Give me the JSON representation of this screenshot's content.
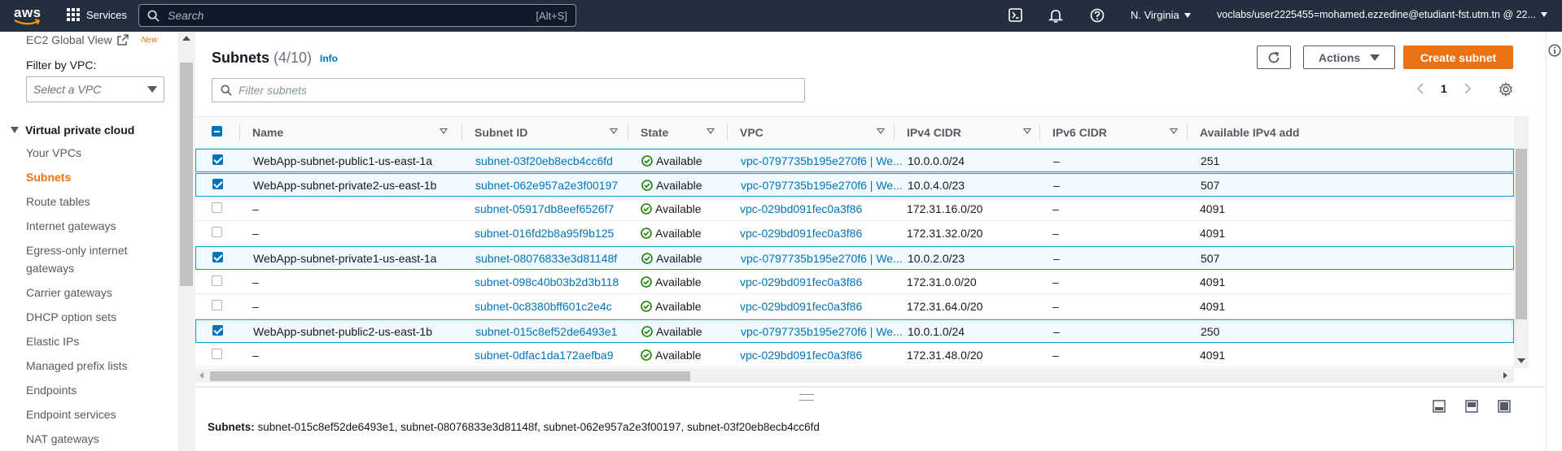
{
  "topbar": {
    "logo_text": "aws",
    "services_label": "Services",
    "search_placeholder": "Search",
    "search_shortcut": "[Alt+S]",
    "region_label": "N. Virginia",
    "account_label": "voclabs/user2225455=mohamed.ezzedine@etudiant-fst.utm.tn @ 22...",
    "colors": {
      "bg": "#232f3e",
      "accent": "#ec7211"
    }
  },
  "sidebar": {
    "global_view_label": "EC2 Global View",
    "new_badge": "New",
    "filter_label": "Filter by VPC:",
    "filter_placeholder": "Select a VPC",
    "section_title": "Virtual private cloud",
    "items": [
      {
        "label": "Your VPCs",
        "active": false
      },
      {
        "label": "Subnets",
        "active": true
      },
      {
        "label": "Route tables",
        "active": false
      },
      {
        "label": "Internet gateways",
        "active": false
      },
      {
        "label": "Egress-only internet",
        "active": false
      },
      {
        "label": "gateways",
        "active": false
      },
      {
        "label": "Carrier gateways",
        "active": false
      },
      {
        "label": "DHCP option sets",
        "active": false
      },
      {
        "label": "Elastic IPs",
        "active": false
      },
      {
        "label": "Managed prefix lists",
        "active": false
      },
      {
        "label": "Endpoints",
        "active": false
      },
      {
        "label": "Endpoint services",
        "active": false
      },
      {
        "label": "NAT gateways",
        "active": false
      }
    ]
  },
  "main": {
    "title": "Subnets",
    "count": "(4/10)",
    "info_label": "Info",
    "actions_label": "Actions",
    "create_label": "Create subnet",
    "filter_placeholder": "Filter subnets",
    "page_number": "1",
    "columns": [
      "Name",
      "Subnet ID",
      "State",
      "VPC",
      "IPv4 CIDR",
      "IPv6 CIDR",
      "Available IPv4 add"
    ],
    "rows": [
      {
        "selected": true,
        "name": "WebApp-subnet-public1-us-east-1a",
        "subnet_id": "subnet-03f20eb8ecb4cc6fd",
        "state": "Available",
        "vpc": "vpc-0797735b195e270f6 | We...",
        "ipv4": "10.0.0.0/24",
        "ipv6": "–",
        "available": "251"
      },
      {
        "selected": true,
        "name": "WebApp-subnet-private2-us-east-1b",
        "subnet_id": "subnet-062e957a2e3f00197",
        "state": "Available",
        "vpc": "vpc-0797735b195e270f6 | We...",
        "ipv4": "10.0.4.0/23",
        "ipv6": "–",
        "available": "507"
      },
      {
        "selected": false,
        "name": "–",
        "subnet_id": "subnet-05917db8eef6526f7",
        "state": "Available",
        "vpc": "vpc-029bd091fec0a3f86",
        "ipv4": "172.31.16.0/20",
        "ipv6": "–",
        "available": "4091"
      },
      {
        "selected": false,
        "name": "–",
        "subnet_id": "subnet-016fd2b8a95f9b125",
        "state": "Available",
        "vpc": "vpc-029bd091fec0a3f86",
        "ipv4": "172.31.32.0/20",
        "ipv6": "–",
        "available": "4091"
      },
      {
        "selected": true,
        "name": "WebApp-subnet-private1-us-east-1a",
        "subnet_id": "subnet-08076833e3d81148f",
        "state": "Available",
        "vpc": "vpc-0797735b195e270f6 | We...",
        "ipv4": "10.0.2.0/23",
        "ipv6": "–",
        "available": "507"
      },
      {
        "selected": false,
        "name": "–",
        "subnet_id": "subnet-098c40b03b2d3b118",
        "state": "Available",
        "vpc": "vpc-029bd091fec0a3f86",
        "ipv4": "172.31.0.0/20",
        "ipv6": "–",
        "available": "4091"
      },
      {
        "selected": false,
        "name": "–",
        "subnet_id": "subnet-0c8380bff601c2e4c",
        "state": "Available",
        "vpc": "vpc-029bd091fec0a3f86",
        "ipv4": "172.31.64.0/20",
        "ipv6": "–",
        "available": "4091"
      },
      {
        "selected": true,
        "name": "WebApp-subnet-public2-us-east-1b",
        "subnet_id": "subnet-015c8ef52de6493e1",
        "state": "Available",
        "vpc": "vpc-0797735b195e270f6 | We...",
        "ipv4": "10.0.1.0/24",
        "ipv6": "–",
        "available": "250"
      },
      {
        "selected": false,
        "name": "–",
        "subnet_id": "subnet-0dfac1da172aefba9",
        "state": "Available",
        "vpc": "vpc-029bd091fec0a3f86",
        "ipv4": "172.31.48.0/20",
        "ipv6": "–",
        "available": "4091"
      }
    ],
    "details_label": "Subnets:",
    "details_value": "subnet-015c8ef52de6493e1, subnet-08076833e3d81148f, subnet-062e957a2e3f00197, subnet-03f20eb8ecb4cc6fd"
  }
}
